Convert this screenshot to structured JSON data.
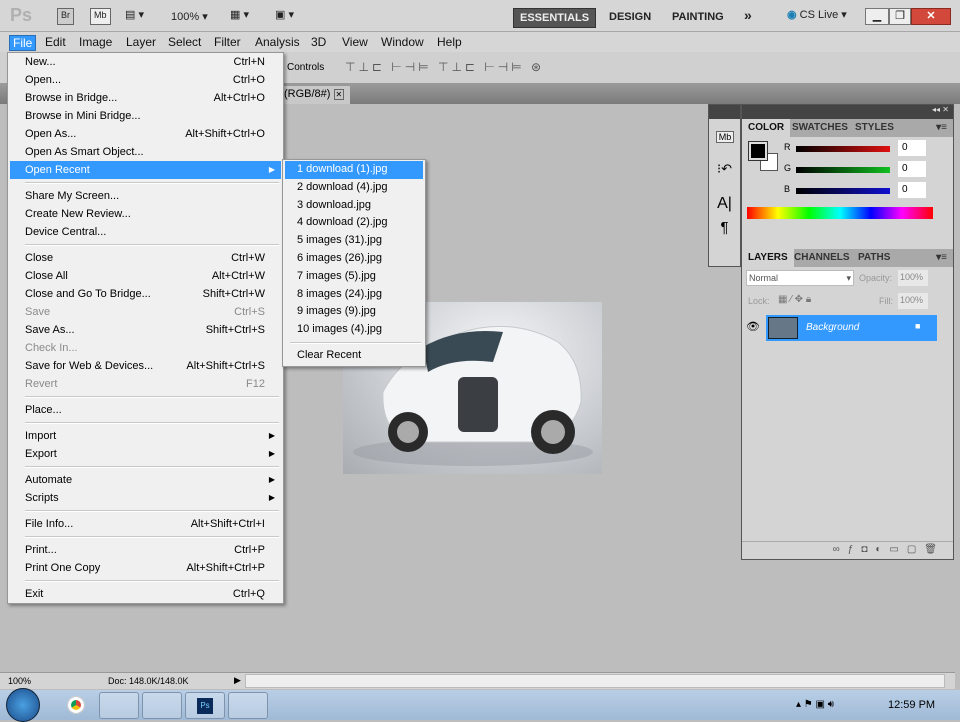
{
  "app": {
    "logo": "Ps",
    "bridge": "Br",
    "minibridge": "Mb",
    "zoom": "100%"
  },
  "workspaces": {
    "essentials": "ESSENTIALS",
    "design": "DESIGN",
    "painting": "PAINTING",
    "more": "»",
    "cslive": "CS Live"
  },
  "menubar": [
    "File",
    "Edit",
    "Image",
    "Layer",
    "Select",
    "Filter",
    "Analysis",
    "3D",
    "View",
    "Window",
    "Help"
  ],
  "options": {
    "controls": "Controls"
  },
  "document_tab": "(RGB/8#)",
  "file_menu": [
    {
      "label": "New...",
      "shortcut": "Ctrl+N"
    },
    {
      "label": "Open...",
      "shortcut": "Ctrl+O"
    },
    {
      "label": "Browse in Bridge...",
      "shortcut": "Alt+Ctrl+O"
    },
    {
      "label": "Browse in Mini Bridge...",
      "shortcut": ""
    },
    {
      "label": "Open As...",
      "shortcut": "Alt+Shift+Ctrl+O"
    },
    {
      "label": "Open As Smart Object...",
      "shortcut": ""
    },
    {
      "label": "Open Recent",
      "shortcut": "",
      "submenu": true,
      "highlighted": true
    },
    {
      "sep": true
    },
    {
      "label": "Share My Screen...",
      "shortcut": ""
    },
    {
      "label": "Create New Review...",
      "shortcut": ""
    },
    {
      "label": "Device Central...",
      "shortcut": ""
    },
    {
      "sep": true
    },
    {
      "label": "Close",
      "shortcut": "Ctrl+W"
    },
    {
      "label": "Close All",
      "shortcut": "Alt+Ctrl+W"
    },
    {
      "label": "Close and Go To Bridge...",
      "shortcut": "Shift+Ctrl+W"
    },
    {
      "label": "Save",
      "shortcut": "Ctrl+S",
      "disabled": true
    },
    {
      "label": "Save As...",
      "shortcut": "Shift+Ctrl+S"
    },
    {
      "label": "Check In...",
      "shortcut": "",
      "disabled": true
    },
    {
      "label": "Save for Web & Devices...",
      "shortcut": "Alt+Shift+Ctrl+S"
    },
    {
      "label": "Revert",
      "shortcut": "F12",
      "disabled": true
    },
    {
      "sep": true
    },
    {
      "label": "Place...",
      "shortcut": ""
    },
    {
      "sep": true
    },
    {
      "label": "Import",
      "shortcut": "",
      "submenu": true
    },
    {
      "label": "Export",
      "shortcut": "",
      "submenu": true
    },
    {
      "sep": true
    },
    {
      "label": "Automate",
      "shortcut": "",
      "submenu": true
    },
    {
      "label": "Scripts",
      "shortcut": "",
      "submenu": true
    },
    {
      "sep": true
    },
    {
      "label": "File Info...",
      "shortcut": "Alt+Shift+Ctrl+I"
    },
    {
      "sep": true
    },
    {
      "label": "Print...",
      "shortcut": "Ctrl+P"
    },
    {
      "label": "Print One Copy",
      "shortcut": "Alt+Shift+Ctrl+P"
    },
    {
      "sep": true
    },
    {
      "label": "Exit",
      "shortcut": "Ctrl+Q"
    }
  ],
  "recent_files": [
    "1 download (1).jpg",
    "2 download (4).jpg",
    "3 download.jpg",
    "4 download (2).jpg",
    "5 images (31).jpg",
    "6 images (26).jpg",
    "7 images (5).jpg",
    "8 images (24).jpg",
    "9 images (9).jpg",
    "10 images (4).jpg"
  ],
  "clear_recent": "Clear Recent",
  "color_panel": {
    "tabs": [
      "COLOR",
      "SWATCHES",
      "STYLES"
    ],
    "channels": [
      {
        "label": "R",
        "value": "0",
        "color": "#e01010"
      },
      {
        "label": "G",
        "value": "0",
        "color": "#10c020"
      },
      {
        "label": "B",
        "value": "0",
        "color": "#1010d0"
      }
    ]
  },
  "layers_panel": {
    "tabs": [
      "LAYERS",
      "CHANNELS",
      "PATHS"
    ],
    "blend_mode": "Normal",
    "opacity_label": "Opacity:",
    "opacity": "100%",
    "lock_label": "Lock:",
    "fill_label": "Fill:",
    "fill": "100%",
    "layers": [
      {
        "name": "Background",
        "selected": true,
        "locked": true
      }
    ]
  },
  "status": {
    "zoom": "100%",
    "doc": "Doc: 148.0K/148.0K"
  },
  "taskbar": {
    "time": "12:59 PM"
  },
  "colors": {
    "highlight": "#3399ff"
  }
}
